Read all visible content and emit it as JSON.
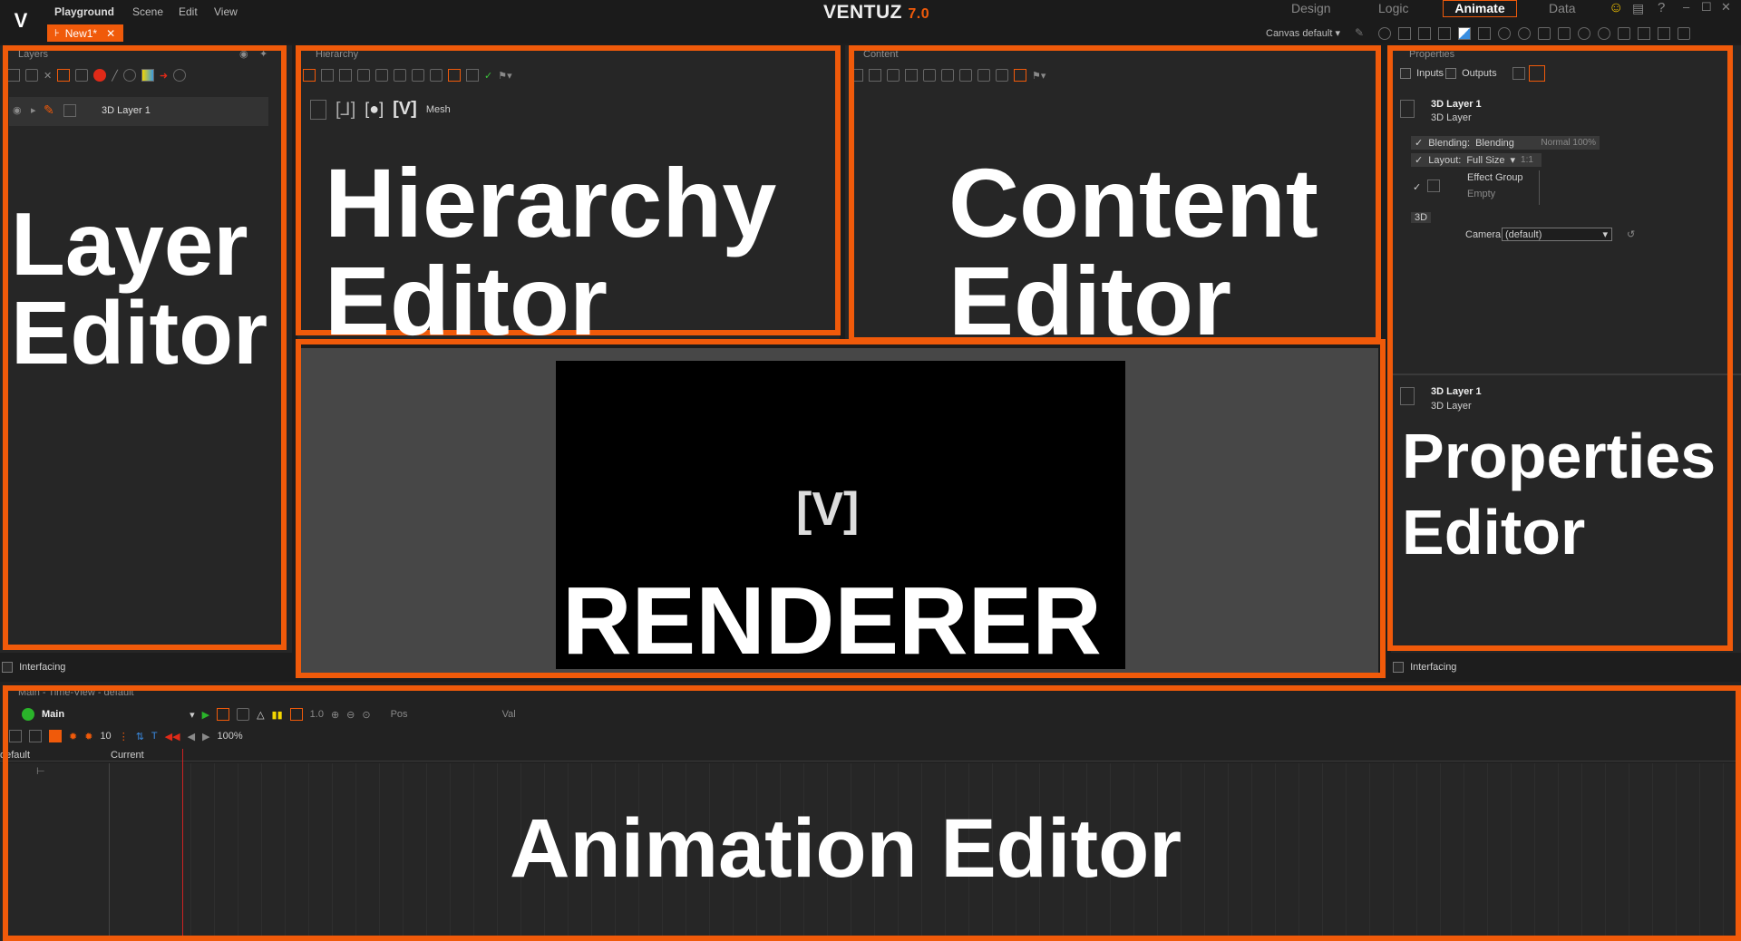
{
  "menubar": {
    "app_menu": "Playground",
    "items": [
      "Scene",
      "Edit",
      "View"
    ],
    "brand": "VENTUZ",
    "version": "7.0",
    "modes": [
      "Design",
      "Logic",
      "Animate",
      "Data"
    ],
    "active_mode": "Animate",
    "canvas_select": "Canvas default"
  },
  "doc_tab": {
    "label": "New1*"
  },
  "layers": {
    "title": "Layers",
    "item_label": "3D Layer 1",
    "interfacing_label": "Interfacing",
    "overlay_line1": "Layer",
    "overlay_line2": "Editor"
  },
  "hierarchy": {
    "title": "Hierarchy",
    "mesh_label": "Mesh",
    "overlay_line1": "Hierarchy",
    "overlay_line2": "Editor"
  },
  "content": {
    "title": "Content",
    "overlay_line1": "Content",
    "overlay_line2": "Editor"
  },
  "renderer": {
    "overlay": "RENDERER"
  },
  "properties": {
    "title": "Properties",
    "inputs_label": "Inputs",
    "outputs_label": "Outputs",
    "node_name": "3D Layer 1",
    "node_type": "3D Layer",
    "blending_label": "Blending:",
    "blending_value": "Blending",
    "blending_mode": "Normal 100%",
    "layout_label": "Layout:",
    "layout_value": "Full Size",
    "layout_ratio": "1:1",
    "effect_group": "Effect Group",
    "effect_empty": "Empty",
    "section_3d": "3D",
    "camera_label": "Camera",
    "camera_value": "(default)",
    "lower_name": "3D Layer 1",
    "lower_type": "3D Layer",
    "interfacing_label": "Interfacing",
    "overlay_line1": "Properties",
    "overlay_line2": "Editor"
  },
  "animation": {
    "title": "Main - Time-View - default",
    "main_label": "Main",
    "speed_value": "1.0",
    "pos_label": "Pos",
    "val_label": "Val",
    "fps_value": "10",
    "zoom_value": "100%",
    "track_default": "default",
    "track_current": "Current",
    "overlay": "Animation Editor"
  },
  "colors": {
    "accent": "#f05a0a",
    "panel_bg": "#262626",
    "app_bg": "#1d1d1d"
  }
}
